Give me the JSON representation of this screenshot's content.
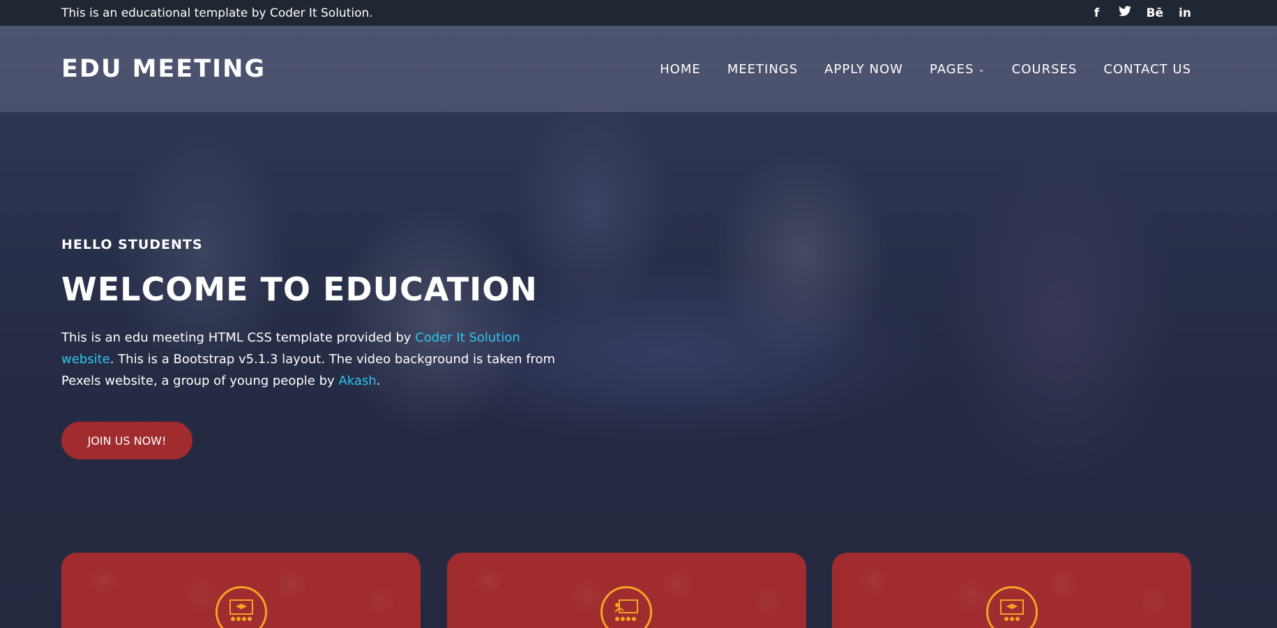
{
  "topbar": {
    "text": "This is an educational template by Coder It Solution.",
    "social": [
      {
        "label": "f",
        "icon": "facebook-icon"
      },
      {
        "label": "🐦",
        "icon": "twitter-icon"
      },
      {
        "label": "Bē",
        "icon": "behance-icon"
      },
      {
        "label": "in",
        "icon": "linkedin-icon"
      }
    ]
  },
  "navbar": {
    "logo": "EDU MEETING",
    "items": [
      {
        "label": "HOME"
      },
      {
        "label": "MEETINGS"
      },
      {
        "label": "APPLY NOW"
      },
      {
        "label": "PAGES"
      },
      {
        "label": "COURSES"
      },
      {
        "label": "CONTACT US"
      }
    ]
  },
  "hero": {
    "eyebrow": "HELLO STUDENTS",
    "headline": "WELCOME TO EDUCATION",
    "desc_part1": "This is an edu meeting HTML CSS template provided by ",
    "desc_link1": "Coder It Solution website",
    "desc_part2": ". This is a Bootstrap v5.1.3 layout. The video background is taken from Pexels website, a group of young people by ",
    "desc_link2": "Akash",
    "desc_part3": ".",
    "button": "JOIN US NOW!"
  },
  "colors": {
    "accent": "#a12c2f",
    "link": "#2ec5f1",
    "icon_ring": "#f5a425",
    "topbar_bg": "#1f2732"
  }
}
